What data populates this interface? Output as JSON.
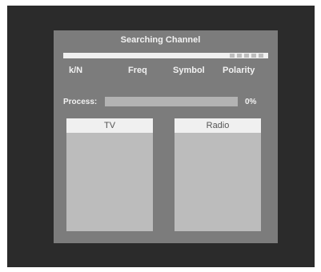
{
  "dialog": {
    "title": "Searching Channel",
    "columns": [
      "k/N",
      "Freq",
      "Symbol",
      "Polarity"
    ],
    "process": {
      "label": "Process:",
      "value": "0%",
      "progress": 0
    },
    "panels": [
      {
        "title": "TV"
      },
      {
        "title": "Radio"
      }
    ]
  },
  "colors": {
    "screen_bg": "#2b2b2b",
    "dialog_bg": "#7c7c7c",
    "text_light": "#f2f2f2",
    "panel_bg": "#bcbcbc",
    "header_bg": "#f0f0f0"
  }
}
